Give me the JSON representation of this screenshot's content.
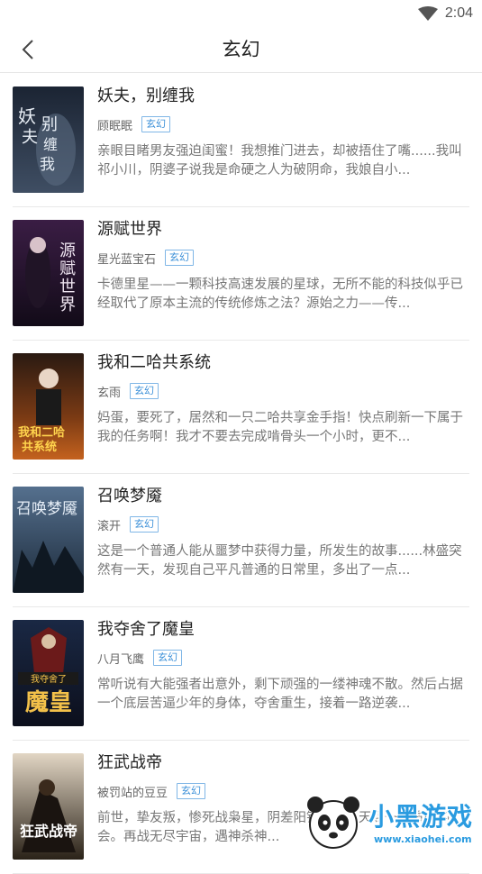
{
  "status_bar": {
    "time": "2:04"
  },
  "header": {
    "title": "玄幻"
  },
  "books": [
    {
      "title": "妖夫，别缠我",
      "author": "顾眠眠",
      "tag": "玄幻",
      "desc": "亲眼目睹男友强迫闺蜜！我想推门进去，却被捂住了嘴......我叫祁小川，阴婆子说我是命硬之人为破阴命，我娘自小...",
      "cover_text": "妖夫别缠我"
    },
    {
      "title": "源赋世界",
      "author": "星光蓝宝石",
      "tag": "玄幻",
      "desc": "卡德里星——一颗科技高速发展的星球，无所不能的科技似乎已经取代了原本主流的传统修炼之法？源始之力——传...",
      "cover_text": "源赋世界"
    },
    {
      "title": "我和二哈共系统",
      "author": "玄雨",
      "tag": "玄幻",
      "desc": "妈蛋，要死了，居然和一只二哈共享金手指！快点刷新一下属于我的任务啊！我才不要去完成啃骨头一个小时，更不...",
      "cover_text": "我和二哈共系统"
    },
    {
      "title": "召唤梦魇",
      "author": "滚开",
      "tag": "玄幻",
      "desc": "这是一个普通人能从噩梦中获得力量，所发生的故事......林盛突然有一天，发现自己平凡普通的日常里，多出了一点...",
      "cover_text": "召唤梦魇"
    },
    {
      "title": "我夺舍了魔皇",
      "author": "八月飞鹰",
      "tag": "玄幻",
      "desc": "常听说有大能强者出意外，剩下顽强的一缕神魂不散。然后占据一个底层苦逼少年的身体，夺舍重生，接着一路逆袭...",
      "cover_text": "魔皇"
    },
    {
      "title": "狂武战帝",
      "author": "被罚站的豆豆",
      "tag": "玄幻",
      "desc": "前世，挚友叛，惨死战枭星，阴差阳错重生，天赐一次重来的机会。再战无尽宇宙，遇神杀神...",
      "cover_text": "狂武战帝"
    }
  ],
  "watermark": {
    "text": "小黑游戏",
    "url": "www.xiaohei.com"
  },
  "colors": {
    "tag": "#3a8fd8",
    "divider": "#e9e9e9"
  }
}
